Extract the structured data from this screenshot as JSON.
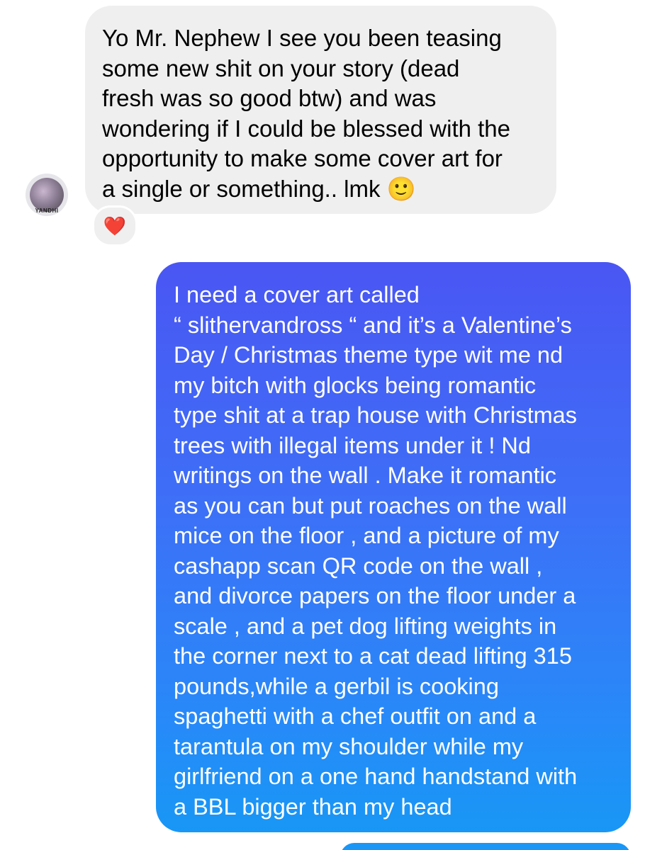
{
  "thread": {
    "incoming_message": {
      "text": "Yo Mr. Nephew I see you been teasing\nsome new shit on your story (dead\nfresh was so good btw) and was\nwondering if I could be blessed with the\nopportunity to make some cover art for\na single or something.. lmk 🙂",
      "avatar_label": "YANDHI",
      "reaction": "❤️"
    },
    "outgoing_message": {
      "text": "I need a cover art called\n“  slithervandross “ and it’s a Valentine’s\nDay / Christmas theme type wit me nd\nmy bitch with glocks being romantic\ntype shit at a trap house with Christmas\ntrees with illegal items under it ! Nd\nwritings on the wall . Make it romantic\nas you can but put roaches on the wall\nmice on the floor , and a picture of my\ncashapp  scan QR code on the wall ,\n and divorce papers on the floor under a\nscale , and a pet dog lifting weights in\nthe corner next to a cat dead lifting 315\npounds,while a gerbil is cooking\nspaghetti with a chef outfit on and a\ntarantula on my shoulder while my\ngirlfriend on a one hand handstand with\na BBL bigger than my head"
    }
  },
  "colors": {
    "incoming_bubble": "#efefef",
    "outgoing_gradient_top": "#4a56f3",
    "outgoing_gradient_bottom": "#1897f6",
    "heart": "#e0162b"
  }
}
